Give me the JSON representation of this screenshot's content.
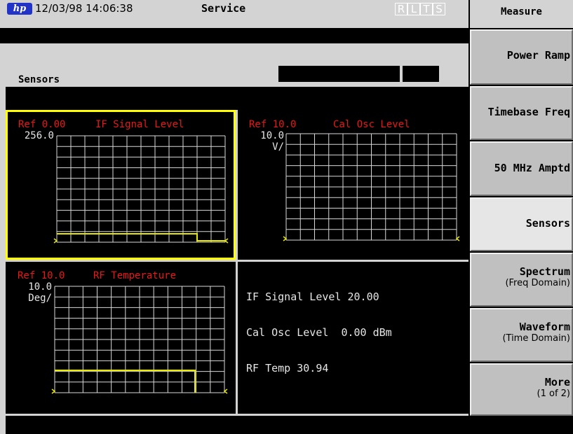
{
  "header": {
    "logo": "hp",
    "datetime": "12/03/98 14:06:38",
    "title": "Service",
    "status_flags": [
      "R",
      "L",
      "T",
      "S"
    ]
  },
  "section": {
    "label": "Sensors"
  },
  "graphs": [
    {
      "ref": "Ref 0.00",
      "name": "IF Signal Level",
      "scale_line1": "256.0",
      "scale_line2": ""
    },
    {
      "ref": "Ref 10.0",
      "name": "Cal Osc Level",
      "scale_line1": "10.0",
      "scale_line2": "V/"
    },
    {
      "ref": "Ref 10.0",
      "name": "RF Temperature",
      "scale_line1": "10.0",
      "scale_line2": "Deg/"
    }
  ],
  "readout": [
    "IF Signal Level 20.00",
    "Cal Osc Level  0.00 dBm",
    "RF Temp 30.94"
  ],
  "menu": {
    "title": "Measure",
    "softkeys": [
      {
        "label": "Power Ramp",
        "sub": ""
      },
      {
        "label": "Timebase Freq",
        "sub": ""
      },
      {
        "label": "50 MHz Amptd",
        "sub": ""
      },
      {
        "label": "Sensors",
        "sub": ""
      },
      {
        "label": "Spectrum",
        "sub": "(Freq Domain)"
      },
      {
        "label": "Waveform",
        "sub": "(Time Domain)"
      },
      {
        "label": "More",
        "sub": "(1 of 2)"
      }
    ]
  },
  "colors": {
    "reference_text": "#e81818",
    "trace": "#e8e800",
    "selected_outline": "#ffff00",
    "graticule": "#d8d8d8"
  }
}
